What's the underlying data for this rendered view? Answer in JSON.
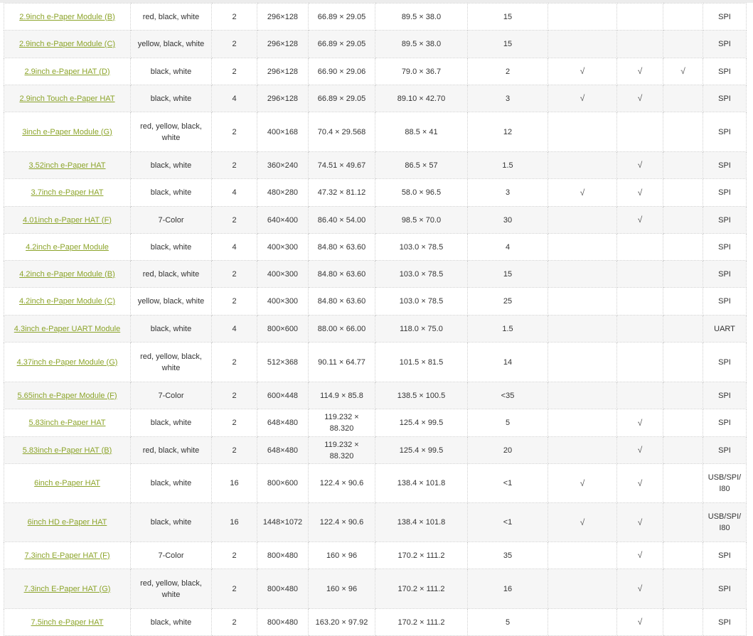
{
  "accent_link_color": "#8ca42a",
  "check_mark": "√",
  "rows": [
    {
      "name": "2.9inch e-Paper Module (B)",
      "colors": "red, black, white",
      "grey": "2",
      "resolution": "296×128",
      "display_size": "66.89 × 29.05",
      "dimension": "89.5 × 38.0",
      "refresh": "15",
      "partial": "",
      "four_grey": "",
      "extra": "",
      "interface": "SPI"
    },
    {
      "name": "2.9inch e-Paper Module (C)",
      "colors": "yellow, black, white",
      "grey": "2",
      "resolution": "296×128",
      "display_size": "66.89 × 29.05",
      "dimension": "89.5 × 38.0",
      "refresh": "15",
      "partial": "",
      "four_grey": "",
      "extra": "",
      "interface": "SPI"
    },
    {
      "name": "2.9inch e-Paper HAT (D)",
      "colors": "black, white",
      "grey": "2",
      "resolution": "296×128",
      "display_size": "66.90 × 29.06",
      "dimension": "79.0 × 36.7",
      "refresh": "2",
      "partial": "√",
      "four_grey": "√",
      "extra": "√",
      "interface": "SPI"
    },
    {
      "name": "2.9inch Touch e-Paper HAT",
      "colors": "black, white",
      "grey": "4",
      "resolution": "296×128",
      "display_size": "66.89 × 29.05",
      "dimension": "89.10 × 42.70",
      "refresh": "3",
      "partial": "√",
      "four_grey": "√",
      "extra": "",
      "interface": "SPI"
    },
    {
      "name": "3inch e-Paper Module (G)",
      "colors": "red, yellow, black, white",
      "grey": "2",
      "resolution": "400×168",
      "display_size": "70.4 × 29.568",
      "dimension": "88.5 × 41",
      "refresh": "12",
      "partial": "",
      "four_grey": "",
      "extra": "",
      "interface": "SPI"
    },
    {
      "name": "3.52inch e-Paper HAT",
      "colors": "black, white",
      "grey": "2",
      "resolution": "360×240",
      "display_size": "74.51 × 49.67",
      "dimension": "86.5 × 57",
      "refresh": "1.5",
      "partial": "",
      "four_grey": "√",
      "extra": "",
      "interface": "SPI"
    },
    {
      "name": "3.7inch e-Paper HAT",
      "colors": "black, white",
      "grey": "4",
      "resolution": "480×280",
      "display_size": "47.32 × 81.12",
      "dimension": "58.0 × 96.5",
      "refresh": "3",
      "partial": "√",
      "four_grey": "√",
      "extra": "",
      "interface": "SPI"
    },
    {
      "name": "4.01inch e-Paper HAT (F)",
      "colors": "7-Color",
      "grey": "2",
      "resolution": "640×400",
      "display_size": "86.40 × 54.00",
      "dimension": "98.5 × 70.0",
      "refresh": "30",
      "partial": "",
      "four_grey": "√",
      "extra": "",
      "interface": "SPI"
    },
    {
      "name": "4.2inch e-Paper Module",
      "colors": "black, white",
      "grey": "4",
      "resolution": "400×300",
      "display_size": "84.80 × 63.60",
      "dimension": "103.0 × 78.5",
      "refresh": "4",
      "partial": "",
      "four_grey": "",
      "extra": "",
      "interface": "SPI"
    },
    {
      "name": "4.2inch e-Paper Module (B)",
      "colors": "red, black, white",
      "grey": "2",
      "resolution": "400×300",
      "display_size": "84.80 × 63.60",
      "dimension": "103.0 × 78.5",
      "refresh": "15",
      "partial": "",
      "four_grey": "",
      "extra": "",
      "interface": "SPI"
    },
    {
      "name": "4.2inch e-Paper Module (C)",
      "colors": "yellow, black, white",
      "grey": "2",
      "resolution": "400×300",
      "display_size": "84.80 × 63.60",
      "dimension": "103.0 × 78.5",
      "refresh": "25",
      "partial": "",
      "four_grey": "",
      "extra": "",
      "interface": "SPI"
    },
    {
      "name": "4.3inch e-Paper UART Module",
      "colors": "black, white",
      "grey": "4",
      "resolution": "800×600",
      "display_size": "88.00 × 66.00",
      "dimension": "118.0 × 75.0",
      "refresh": "1.5",
      "partial": "",
      "four_grey": "",
      "extra": "",
      "interface": "UART"
    },
    {
      "name": "4.37inch e-Paper Module (G)",
      "colors": "red, yellow, black, white",
      "grey": "2",
      "resolution": "512×368",
      "display_size": "90.11 × 64.77",
      "dimension": "101.5 × 81.5",
      "refresh": "14",
      "partial": "",
      "four_grey": "",
      "extra": "",
      "interface": "SPI"
    },
    {
      "name": "5.65inch e-Paper Module (F)",
      "colors": "7-Color",
      "grey": "2",
      "resolution": "600×448",
      "display_size": "114.9 × 85.8",
      "dimension": "138.5 × 100.5",
      "refresh": "<35",
      "partial": "",
      "four_grey": "",
      "extra": "",
      "interface": "SPI"
    },
    {
      "name": "5.83inch e-Paper HAT",
      "colors": "black, white",
      "grey": "2",
      "resolution": "648×480",
      "display_size": "119.232 × 88.320",
      "dimension": "125.4 × 99.5",
      "refresh": "5",
      "partial": "",
      "four_grey": "√",
      "extra": "",
      "interface": "SPI"
    },
    {
      "name": "5.83inch e-Paper HAT (B)",
      "colors": "red, black, white",
      "grey": "2",
      "resolution": "648×480",
      "display_size": "119.232 × 88.320",
      "dimension": "125.4 × 99.5",
      "refresh": "20",
      "partial": "",
      "four_grey": "√",
      "extra": "",
      "interface": "SPI"
    },
    {
      "name": "6inch e-Paper HAT",
      "colors": "black, white",
      "grey": "16",
      "resolution": "800×600",
      "display_size": "122.4 × 90.6",
      "dimension": "138.4 × 101.8",
      "refresh": "<1",
      "partial": "√",
      "four_grey": "√",
      "extra": "",
      "interface": "USB/SPI/ I80"
    },
    {
      "name": "6inch HD e-Paper HAT",
      "colors": "black, white",
      "grey": "16",
      "resolution": "1448×1072",
      "display_size": "122.4 × 90.6",
      "dimension": "138.4 × 101.8",
      "refresh": "<1",
      "partial": "√",
      "four_grey": "√",
      "extra": "",
      "interface": "USB/SPI/ I80"
    },
    {
      "name": "7.3inch E-Paper HAT (F)",
      "colors": "7-Color",
      "grey": "2",
      "resolution": "800×480",
      "display_size": "160 × 96",
      "dimension": "170.2 × 111.2",
      "refresh": "35",
      "partial": "",
      "four_grey": "√",
      "extra": "",
      "interface": "SPI"
    },
    {
      "name": "7.3inch E-Paper HAT (G)",
      "colors": "red, yellow, black, white",
      "grey": "2",
      "resolution": "800×480",
      "display_size": "160 × 96",
      "dimension": "170.2 × 111.2",
      "refresh": "16",
      "partial": "",
      "four_grey": "√",
      "extra": "",
      "interface": "SPI"
    },
    {
      "name": "7.5inch e-Paper HAT",
      "colors": "black, white",
      "grey": "2",
      "resolution": "800×480",
      "display_size": "163.20 × 97.92",
      "dimension": "170.2 × 111.2",
      "refresh": "5",
      "partial": "",
      "four_grey": "√",
      "extra": "",
      "interface": "SPI"
    }
  ]
}
